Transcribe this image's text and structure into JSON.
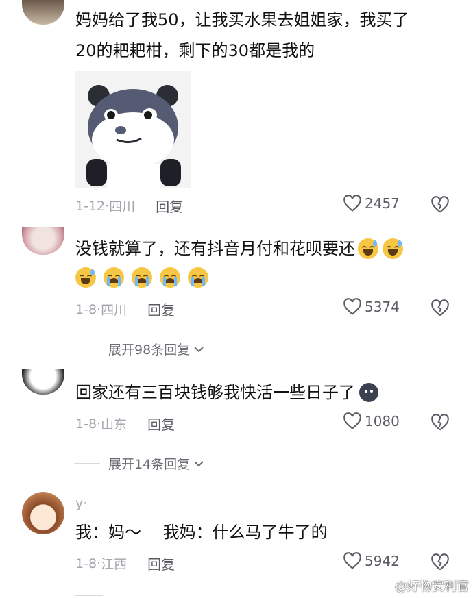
{
  "comments": [
    {
      "text_line1": "妈妈给了我50，让我买水果去姐姐家，我买了",
      "text_line2": "20的耙耙柑，剩下的30都是我的",
      "sticker": "panda-meme-sticker",
      "date": "1-12",
      "location": "四川",
      "reply_label": "回复",
      "likes": "2457"
    },
    {
      "text_line1": "没钱就算了，还有抖音月付和花呗要还",
      "emojis_line1": [
        "grinning-sweat-emoji",
        "grinning-sweat-emoji"
      ],
      "emojis_line2": [
        "grinning-sweat-emoji",
        "crying-emoji",
        "crying-emoji",
        "crying-emoji",
        "crying-emoji"
      ],
      "date": "1-8",
      "location": "四川",
      "reply_label": "回复",
      "likes": "5374",
      "expand_label": "展开98条回复"
    },
    {
      "text_line1": "回家还有三百块钱够我快活一些日子了",
      "emoji_end": "dark-rock-emoji",
      "date": "1-8",
      "location": "山东",
      "reply_label": "回复",
      "likes": "1080",
      "expand_label": "展开14条回复"
    },
    {
      "username": "y·",
      "text_line1": "我：妈～　 我妈：什么马了牛了的",
      "date": "1-8",
      "location": "江西",
      "reply_label": "回复",
      "likes": "5942"
    }
  ],
  "watermark": "@好物安利官",
  "colors": {
    "meta_gray": "#a3a5ac",
    "text": "#111111",
    "emoji_yellow": "#f6c744"
  }
}
